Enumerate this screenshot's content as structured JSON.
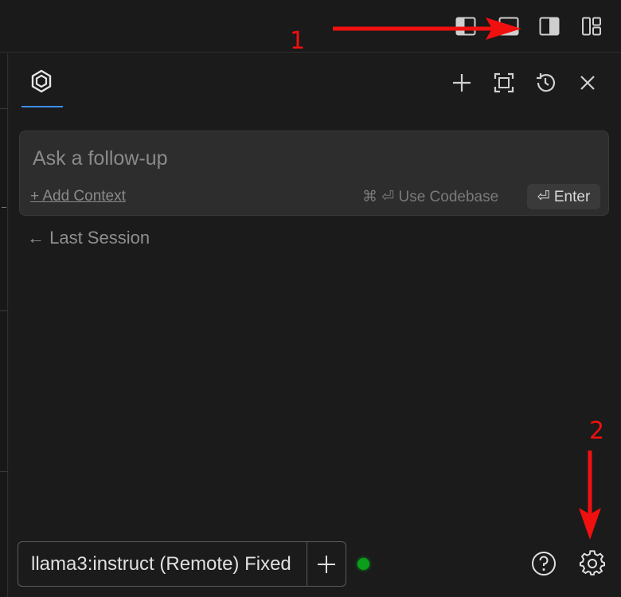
{
  "panel": {
    "input_placeholder": "Ask a follow-up",
    "add_context_label": "+ Add Context",
    "use_codebase_label": "⌘ ⏎ Use Codebase",
    "enter_label": "⏎ Enter",
    "last_session_label": "← Last Session"
  },
  "footer": {
    "model_label": "llama3:instruct (Remote) Fixed",
    "status_color": "#0b9e1a"
  },
  "annotations": {
    "label_1": "1",
    "label_2": "2",
    "color": "#f01010"
  },
  "icons": {
    "top_layout": [
      "toggle-primary-sidebar-icon",
      "toggle-panel-icon",
      "toggle-secondary-sidebar-icon",
      "customize-layout-icon"
    ],
    "panel_actions": [
      "plus-icon",
      "fullscreen-icon",
      "history-icon",
      "close-icon"
    ],
    "footer": [
      "help-icon",
      "gear-icon"
    ]
  }
}
